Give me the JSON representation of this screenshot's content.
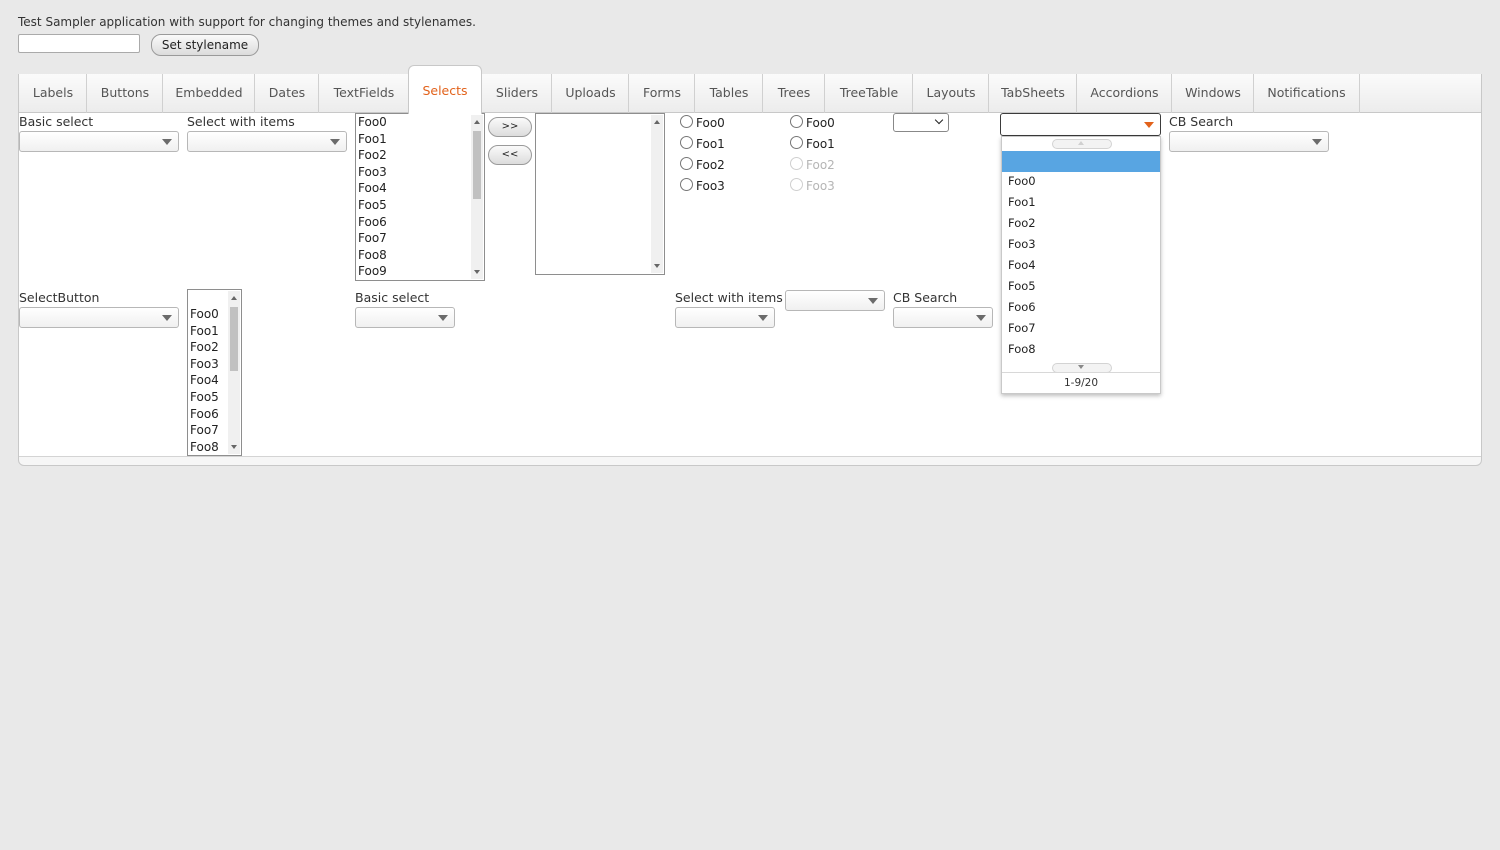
{
  "header": {
    "description": "Test Sampler application with support for changing themes and stylenames.",
    "stylename_value": "",
    "set_stylename_label": "Set stylename"
  },
  "tabs": [
    {
      "label": "Labels"
    },
    {
      "label": "Buttons"
    },
    {
      "label": "Embedded"
    },
    {
      "label": "Dates"
    },
    {
      "label": "TextFields"
    },
    {
      "label": "Selects"
    },
    {
      "label": "Sliders"
    },
    {
      "label": "Uploads"
    },
    {
      "label": "Forms"
    },
    {
      "label": "Tables"
    },
    {
      "label": "Trees"
    },
    {
      "label": "TreeTable"
    },
    {
      "label": "Layouts"
    },
    {
      "label": "TabSheets"
    },
    {
      "label": "Accordions"
    },
    {
      "label": "Windows"
    },
    {
      "label": "Notifications"
    }
  ],
  "active_tab": "Selects",
  "selects": {
    "basic_select_caption": "Basic select",
    "select_with_items_caption": "Select with items",
    "cb_search_caption": "CB Search",
    "select_button_caption": "SelectButton",
    "basic_select_caption_2": "Basic select",
    "select_with_items_caption_2": "Select with items",
    "cb_search_caption_2": "CB Search",
    "list_select_items": [
      "Foo0",
      "Foo1",
      "Foo2",
      "Foo3",
      "Foo4",
      "Foo5",
      "Foo6",
      "Foo7",
      "Foo8",
      "Foo9"
    ],
    "twincol_add_label": ">>",
    "twincol_remove_label": "<<",
    "option_group": [
      "Foo0",
      "Foo1",
      "Foo2",
      "Foo3"
    ],
    "option_group_disabled": [
      "Foo0",
      "Foo1",
      "Foo2",
      "Foo3"
    ],
    "list_select_2_items": [
      "Foo0",
      "Foo1",
      "Foo2",
      "Foo3",
      "Foo4",
      "Foo5",
      "Foo6",
      "Foo7",
      "Foo8"
    ],
    "combo_popup": {
      "options": [
        "Foo0",
        "Foo1",
        "Foo2",
        "Foo3",
        "Foo4",
        "Foo5",
        "Foo6",
        "Foo7",
        "Foo8"
      ],
      "status": "1-9/20"
    }
  },
  "colors": {
    "accent": "#e2621b",
    "selection": "#58a5e2",
    "background": "#e9e9e9"
  }
}
